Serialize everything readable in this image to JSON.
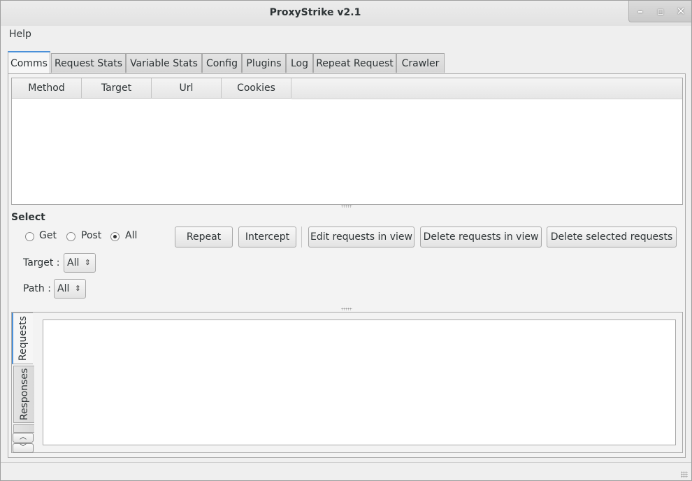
{
  "window": {
    "title": "ProxyStrike v2.1",
    "controls": {
      "minimize": "–",
      "maximize": "▫",
      "close": "✕"
    }
  },
  "menubar": {
    "items": [
      "Help"
    ]
  },
  "tabs": [
    "Comms",
    "Request Stats",
    "Variable Stats",
    "Config",
    "Plugins",
    "Log",
    "Repeat Request",
    "Crawler"
  ],
  "active_tab": "Comms",
  "comms": {
    "columns": [
      "Method",
      "Target",
      "Url",
      "Cookies"
    ],
    "rows": [],
    "select_label": "Select",
    "radios": [
      {
        "label": "Get",
        "checked": false
      },
      {
        "label": "Post",
        "checked": false
      },
      {
        "label": "All",
        "checked": true
      }
    ],
    "buttons": {
      "repeat": "Repeat",
      "intercept": "Intercept",
      "edit_in_view": "Edit requests in view",
      "delete_in_view": "Delete requests in view",
      "delete_selected": "Delete selected requests"
    },
    "target": {
      "label": "Target :",
      "value": "All"
    },
    "path": {
      "label": "Path :",
      "value": "All"
    },
    "lower_tabs": [
      "Requests",
      "Responses"
    ],
    "lower_active": "Requests",
    "scroll": {
      "up": "︿",
      "down": "﹀"
    }
  },
  "colors": {
    "accent": "#4a90d9"
  }
}
